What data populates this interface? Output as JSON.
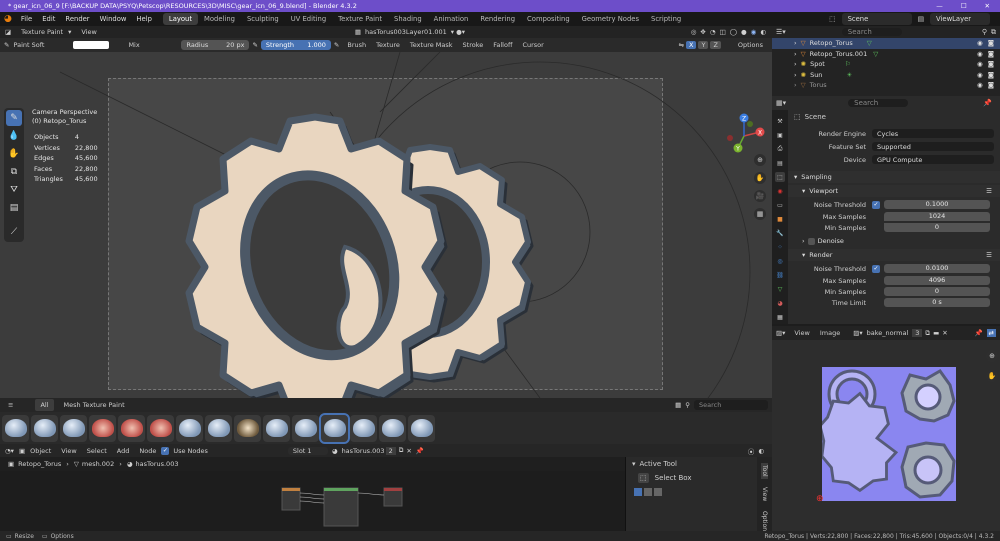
{
  "window": {
    "title": "* gear_icn_06_9 [F:\\BACKUP DATA\\PSYQ\\Petscop\\RESOURCES\\3D\\MISC\\gear_icn_06_9.blend] - Blender 4.3.2",
    "minimize": "—",
    "maximize": "☐",
    "close": "✕"
  },
  "menu": {
    "items": [
      "File",
      "Edit",
      "Render",
      "Window",
      "Help"
    ]
  },
  "workspaces": {
    "tabs": [
      "Layout",
      "Modeling",
      "Sculpting",
      "UV Editing",
      "Texture Paint",
      "Shading",
      "Animation",
      "Rendering",
      "Compositing",
      "Geometry Nodes",
      "Scripting"
    ],
    "active": "Layout"
  },
  "scene": {
    "name": "Scene",
    "view_layer": "ViewLayer"
  },
  "viewport_header": {
    "mode": "Texture Paint",
    "view": "View",
    "texture_slot": "hasTorus003Layer01.001"
  },
  "tool_header": {
    "brush_name": "Paint Soft",
    "blend": "Mix",
    "radius_label": "Radius",
    "radius_value": "20 px",
    "strength_label": "Strength",
    "strength_value": "1.000",
    "menus": [
      "Brush",
      "Texture",
      "Texture Mask",
      "Stroke",
      "Falloff",
      "Cursor"
    ],
    "axes": [
      "X",
      "Y",
      "Z"
    ],
    "options": "Options"
  },
  "overlay_text": {
    "camera": "Camera Perspective",
    "object": "(0) Retopo_Torus",
    "stats": [
      {
        "label": "Objects",
        "value": "4"
      },
      {
        "label": "Vertices",
        "value": "22,800"
      },
      {
        "label": "Edges",
        "value": "45,600"
      },
      {
        "label": "Faces",
        "value": "22,800"
      },
      {
        "label": "Triangles",
        "value": "45,600"
      }
    ]
  },
  "gizmo": {
    "x": "X",
    "y": "Y",
    "z": "Z"
  },
  "brush_asset_bar": {
    "tabs": [
      "All",
      "Mesh Texture Paint"
    ],
    "search_placeholder": "Search"
  },
  "node_header": {
    "object_menu": "Object",
    "menus": [
      "View",
      "Select",
      "Add",
      "Node"
    ],
    "use_nodes_label": "Use Nodes",
    "slot": "Slot 1",
    "material": "hasTorus.003",
    "users": "2"
  },
  "node_breadcrumb": {
    "object": "Retopo_Torus",
    "mesh": "mesh.002",
    "material": "hasTorus.003"
  },
  "npanel": {
    "title": "Active Tool",
    "tool": "Select Box",
    "tabs": [
      "Tool",
      "View",
      "Option"
    ]
  },
  "status": {
    "left": [
      "Resize",
      "Options"
    ],
    "right": "Retopo_Torus | Verts:22,800 | Faces:22,800 | Tris:45,600 | Objects:0/4 | 4.3.2"
  },
  "outliner": {
    "search_placeholder": "Search",
    "items": [
      {
        "name": "Retopo_Torus",
        "type": "mesh",
        "selected": true
      },
      {
        "name": "Retopo_Torus.001",
        "type": "mesh",
        "selected": false
      },
      {
        "name": "Spot",
        "type": "light",
        "selected": false
      },
      {
        "name": "Sun",
        "type": "light",
        "selected": false
      },
      {
        "name": "Torus",
        "type": "mesh",
        "selected": false
      }
    ]
  },
  "properties": {
    "search_placeholder": "Search",
    "context": "Scene",
    "render_engine_label": "Render Engine",
    "render_engine": "Cycles",
    "feature_set_label": "Feature Set",
    "feature_set": "Supported",
    "device_label": "Device",
    "device": "GPU Compute",
    "sampling": "Sampling",
    "viewport": "Viewport",
    "viewport_noise_label": "Noise Threshold",
    "viewport_noise": "0.1000",
    "viewport_max_label": "Max Samples",
    "viewport_max": "1024",
    "viewport_min_label": "Min Samples",
    "viewport_min": "0",
    "denoise": "Denoise",
    "render": "Render",
    "render_noise_label": "Noise Threshold",
    "render_noise": "0.0100",
    "render_max_label": "Max Samples",
    "render_max": "4096",
    "render_min_label": "Min Samples",
    "render_min": "0",
    "time_limit_label": "Time Limit",
    "time_limit": "0 s"
  },
  "image_editor": {
    "view": "View",
    "image": "Image",
    "image_name": "bake_normal",
    "users": "3"
  },
  "colors": {
    "accent": "#4772b3",
    "title_bar": "#6d4ec9",
    "gear_face": "#e9d6c0",
    "gear_rim": "#4c5866",
    "normal_map": "#8a86f0"
  }
}
